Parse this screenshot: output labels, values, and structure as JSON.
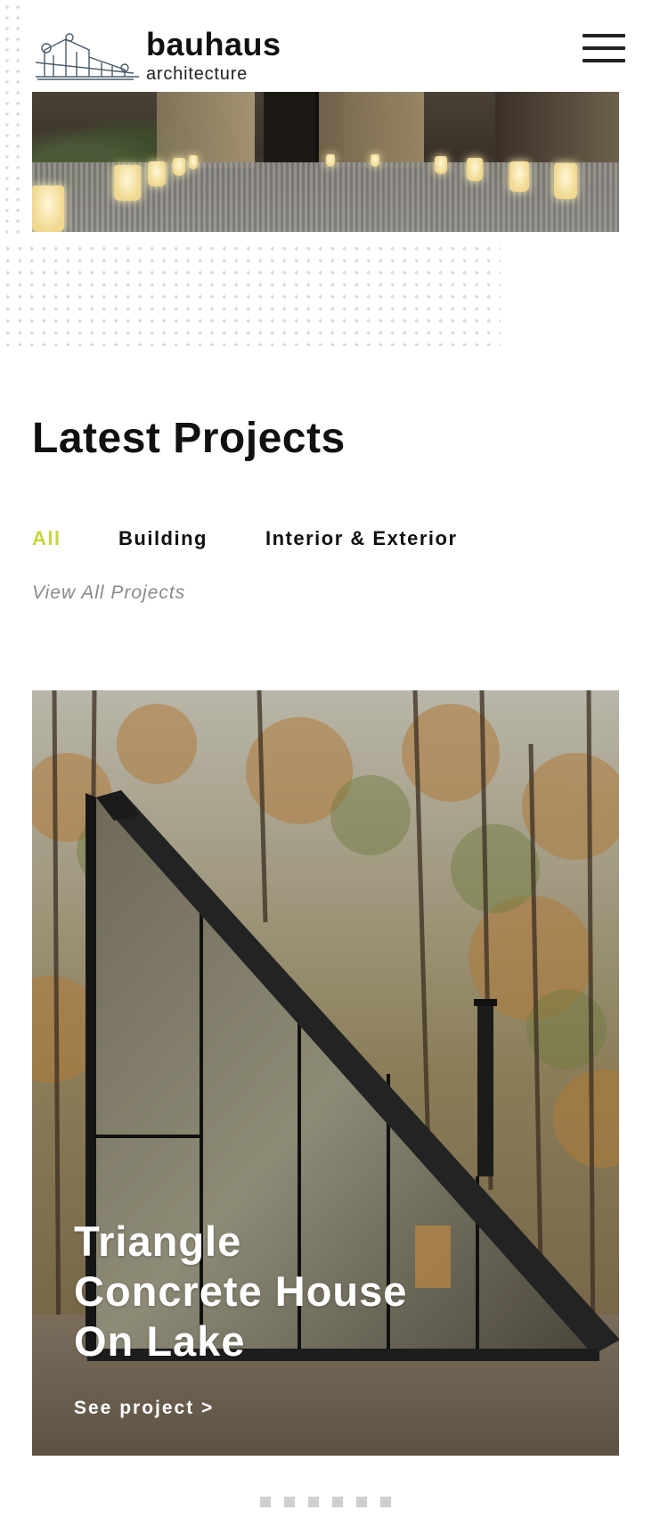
{
  "header": {
    "brand_name": "bauhaus",
    "brand_subtitle": "architecture",
    "logo_icon": "building-sketch-icon",
    "menu_icon": "hamburger-menu-icon"
  },
  "hero": {
    "alt": "Illuminated corridor with lanterns"
  },
  "projects": {
    "title": "Latest Projects",
    "filters": [
      {
        "label": "All",
        "active": true
      },
      {
        "label": "Building",
        "active": false
      },
      {
        "label": "Interior & Exterior",
        "active": false
      }
    ],
    "view_all": "View All Projects",
    "card": {
      "title": "Triangle\nConcrete House\nOn Lake",
      "link": "See project  >"
    },
    "pagination": {
      "pages": 6,
      "current": 1
    }
  },
  "colors": {
    "accent": "#c8d43a",
    "text": "#111111",
    "muted": "#8a8a8a",
    "pager": "#cfcfcf"
  }
}
